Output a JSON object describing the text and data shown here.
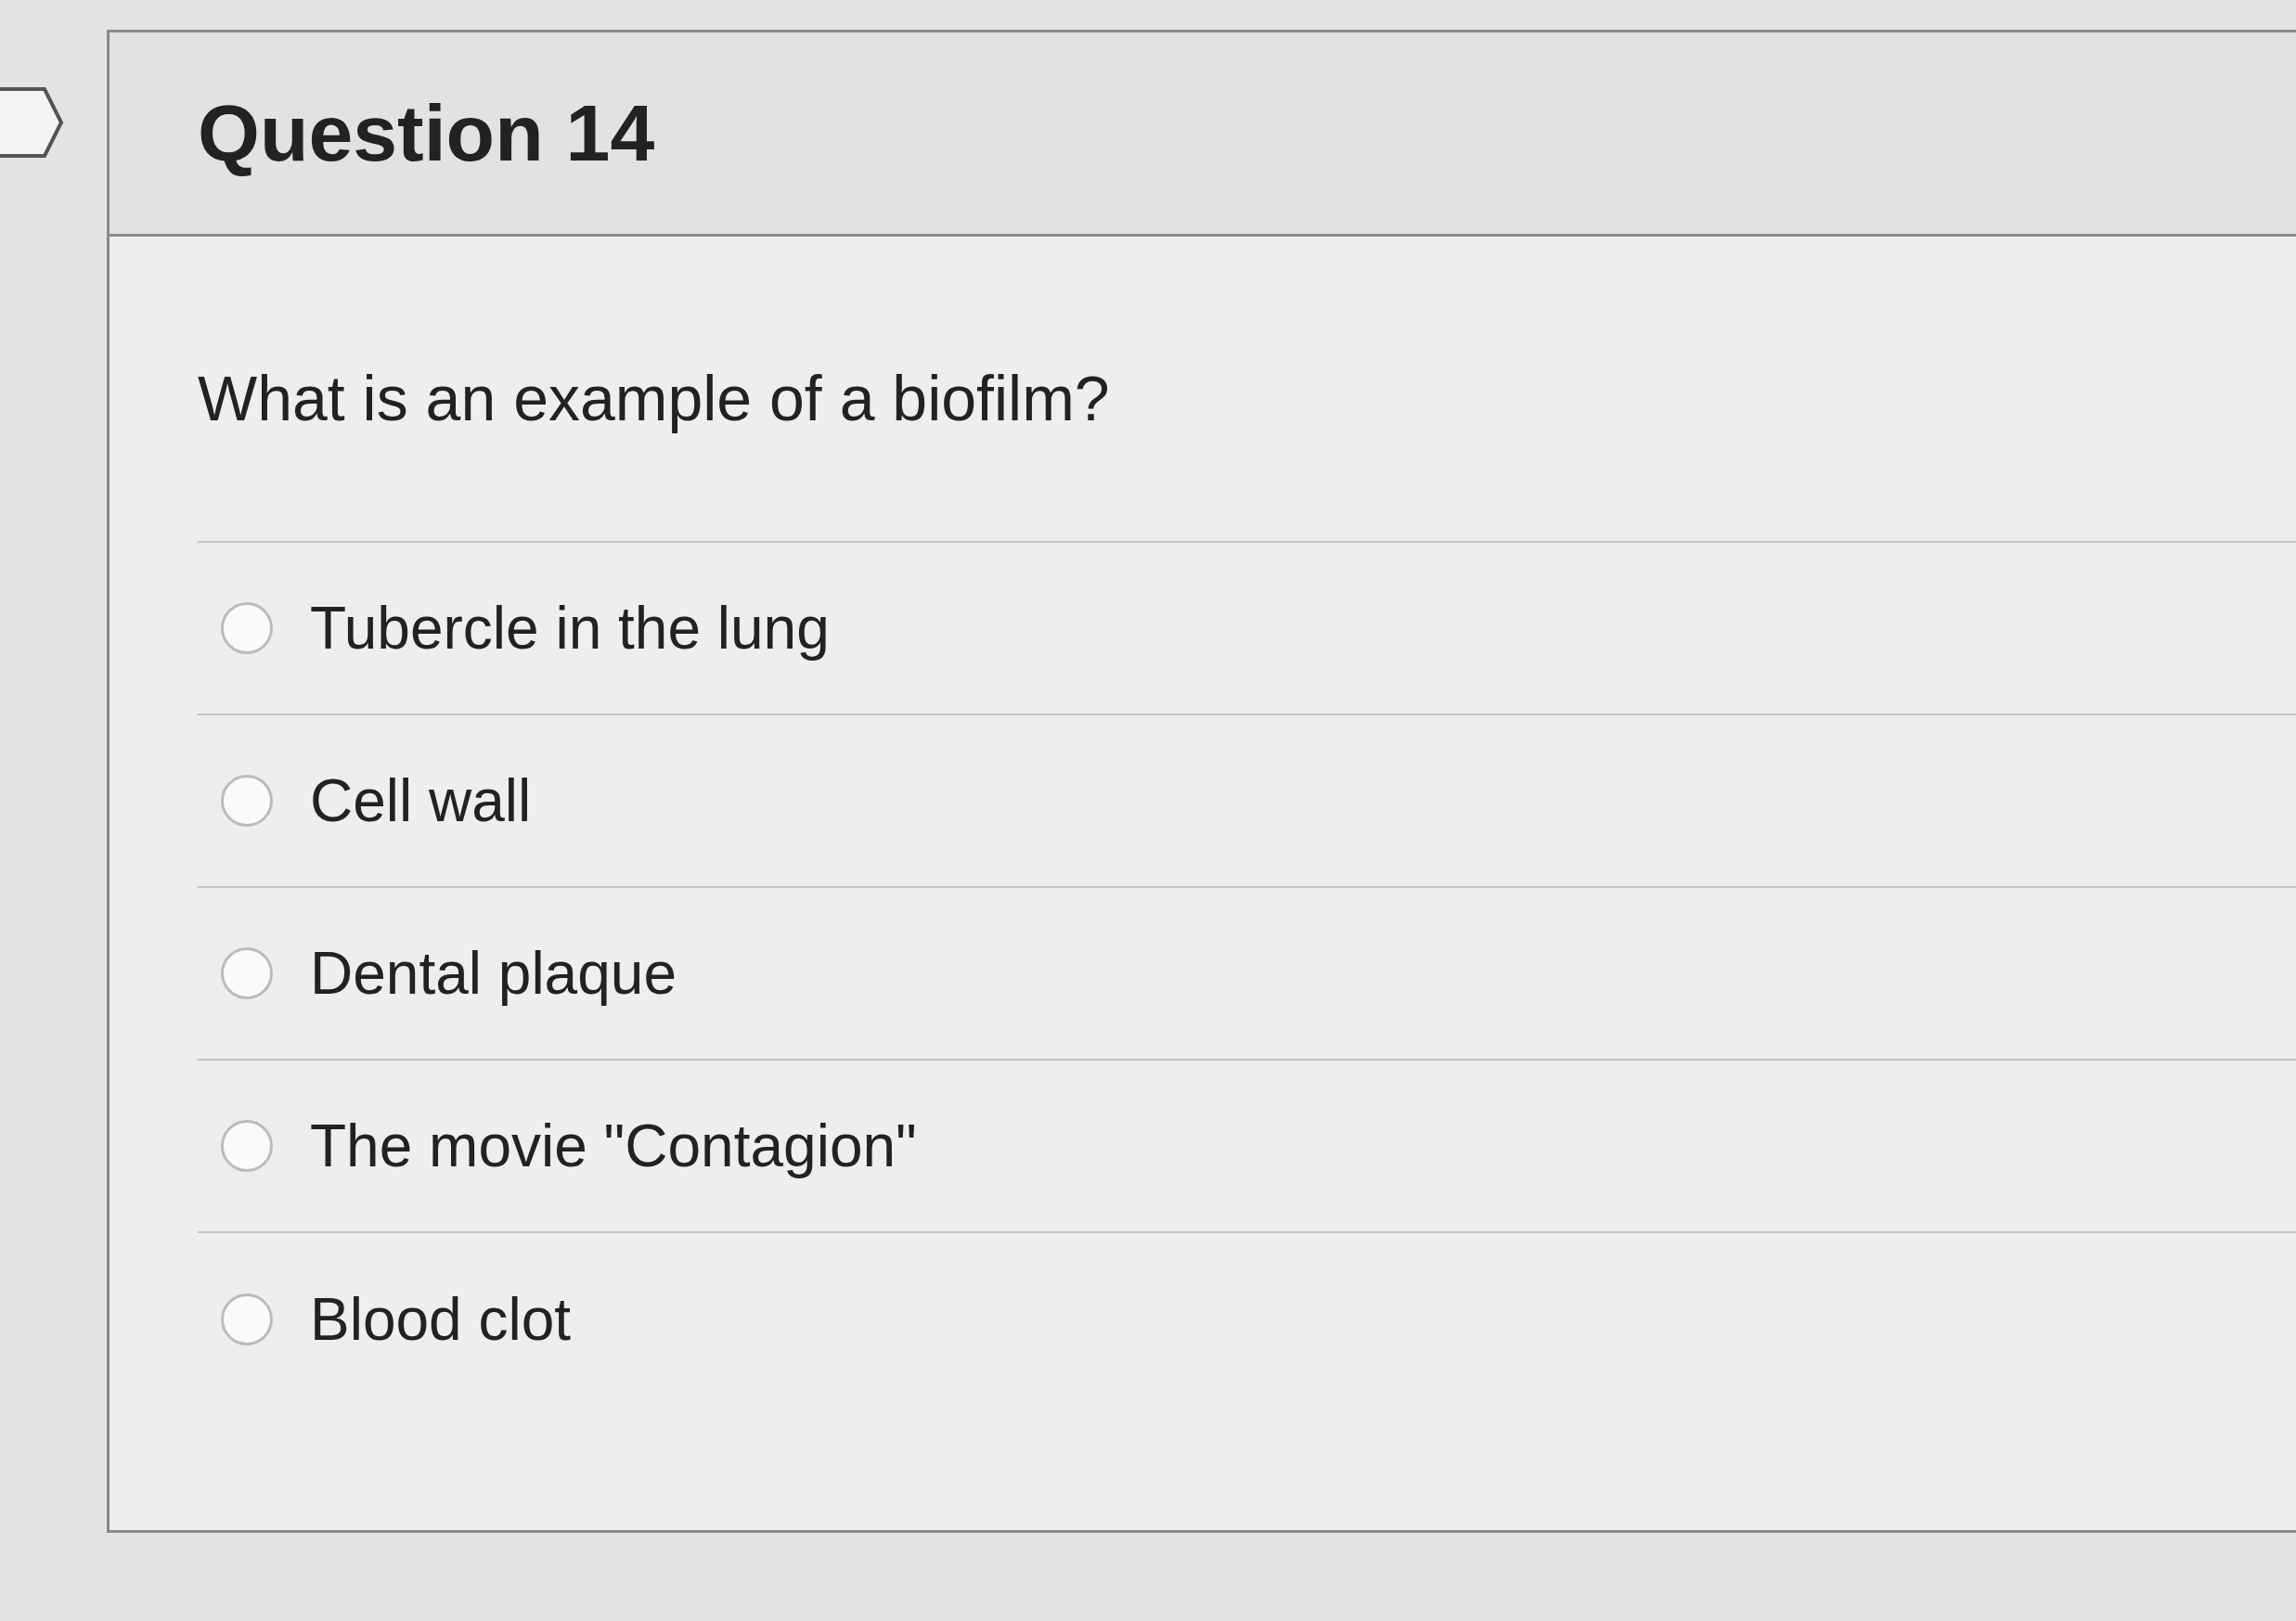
{
  "question": {
    "title": "Question 14",
    "prompt": "What is an example of a biofilm?",
    "options": [
      {
        "label": "Tubercle in the lung",
        "selected": false
      },
      {
        "label": "Cell wall",
        "selected": false
      },
      {
        "label": "Dental plaque",
        "selected": false
      },
      {
        "label": "The movie \"Contagion\"",
        "selected": false
      },
      {
        "label": "Blood clot",
        "selected": false
      }
    ]
  }
}
